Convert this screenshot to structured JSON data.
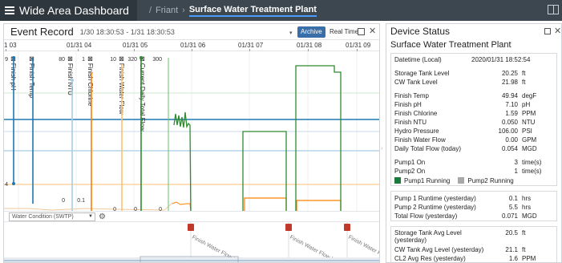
{
  "topbar": {
    "app_title": "Wide Area Dashboard",
    "breadcrumb_sep": "/",
    "breadcrumb_parent": "Friant",
    "breadcrumb_arrow": "›",
    "breadcrumb_current": "Surface Water Treatment Plant"
  },
  "event_record": {
    "title": "Event Record",
    "range": "1/30 18:30:53 - 1/31 18:30:53",
    "archive_label": "Archive",
    "realtime_label": "Real Time",
    "close_glyph": "✕",
    "filter_value": "Water Condition (SWTP)",
    "time_ticks": [
      "1 03",
      "01/31 04",
      "01/31 05",
      "01/31 06",
      "01/31 07",
      "01/31 08",
      "01/31 09"
    ],
    "series": [
      {
        "name": "Finish pH",
        "max_label": "9",
        "min_label": "4",
        "color": "#1f78b4"
      },
      {
        "name": "Finish Temp",
        "max_label": "",
        "min_label": "",
        "color": "#1f78b4"
      },
      {
        "name": "Finish NTU",
        "max_label": "80",
        "min_label": "0",
        "color": "#a6cee3"
      },
      {
        "name": "Finish Chlorine",
        "max_label": "1",
        "min_label": "0.1",
        "color": "#ff7f00"
      },
      {
        "name": "Finish Water Flow",
        "max_label": "10",
        "min_label": "0",
        "color": "#fdbf6f"
      },
      {
        "name": "Current Daily Total Flow",
        "max_label": "320",
        "min_label": "0",
        "color": "#33a02c"
      },
      {
        "name": "",
        "max_label": "300",
        "min_label": "0",
        "color": "#33a02c"
      }
    ],
    "alarm_text": "Finish Water Flow below",
    "colors": {
      "pump1": "#2e8b2e",
      "ph": "#1f78b4",
      "ntu": "#a6cee3",
      "chlorine": "#ff7f00",
      "flow": "#fdbf6f",
      "alarm": "#c0392b"
    }
  },
  "device_status": {
    "title": "Device Status",
    "close_glyph": "✕",
    "plant": "Surface Water Treatment Plant",
    "datetime_label": "Datetime (Local)",
    "datetime_value": "2020/01/31 18:52:54",
    "rows_a": [
      {
        "label": "Storage Tank Level",
        "value": "20.25",
        "unit": "ft"
      },
      {
        "label": "CW Tank Level",
        "value": "21.98",
        "unit": "ft"
      }
    ],
    "rows_b": [
      {
        "label": "Finish Temp",
        "value": "49.94",
        "unit": "degF"
      },
      {
        "label": "Finish pH",
        "value": "7.10",
        "unit": "pH"
      },
      {
        "label": "Finish Chlorine",
        "value": "1.59",
        "unit": "PPM"
      },
      {
        "label": "Finish NTU",
        "value": "0.050",
        "unit": "NTU"
      },
      {
        "label": "Hydro Pressure",
        "value": "106.00",
        "unit": "PSI"
      },
      {
        "label": "Finish Water Flow",
        "value": "0.00",
        "unit": "GPM"
      },
      {
        "label": "Daily Total Flow (today)",
        "value": "0.054",
        "unit": "MGD"
      }
    ],
    "rows_c": [
      {
        "label": "Pump1 On",
        "value": "3",
        "unit": "time(s)"
      },
      {
        "label": "Pump2 On",
        "value": "1",
        "unit": "time(s)"
      }
    ],
    "pump1_status": "Pump1 Running",
    "pump2_status": "Pump2 Running",
    "pump1_color": "#1e7a3c",
    "pump2_color": "#a8a8a8",
    "rows_d": [
      {
        "label": "Pump 1 Runtime (yesterday)",
        "value": "0.1",
        "unit": "hrs"
      },
      {
        "label": "Pump 2 Runtime (yesterday)",
        "value": "5.5",
        "unit": "hrs"
      },
      {
        "label": "Total Flow (yesterday)",
        "value": "0.071",
        "unit": "MGD"
      }
    ],
    "rows_e": [
      {
        "label": "Storage Tank Avg Level (yesterday)",
        "value": "20.5",
        "unit": "ft"
      },
      {
        "label": "CW Tank Avg Level (yesterday)",
        "value": "21.1",
        "unit": "ft"
      },
      {
        "label": "CL2 Avg Res (yesterday)",
        "value": "1.6",
        "unit": "PPM"
      }
    ]
  }
}
